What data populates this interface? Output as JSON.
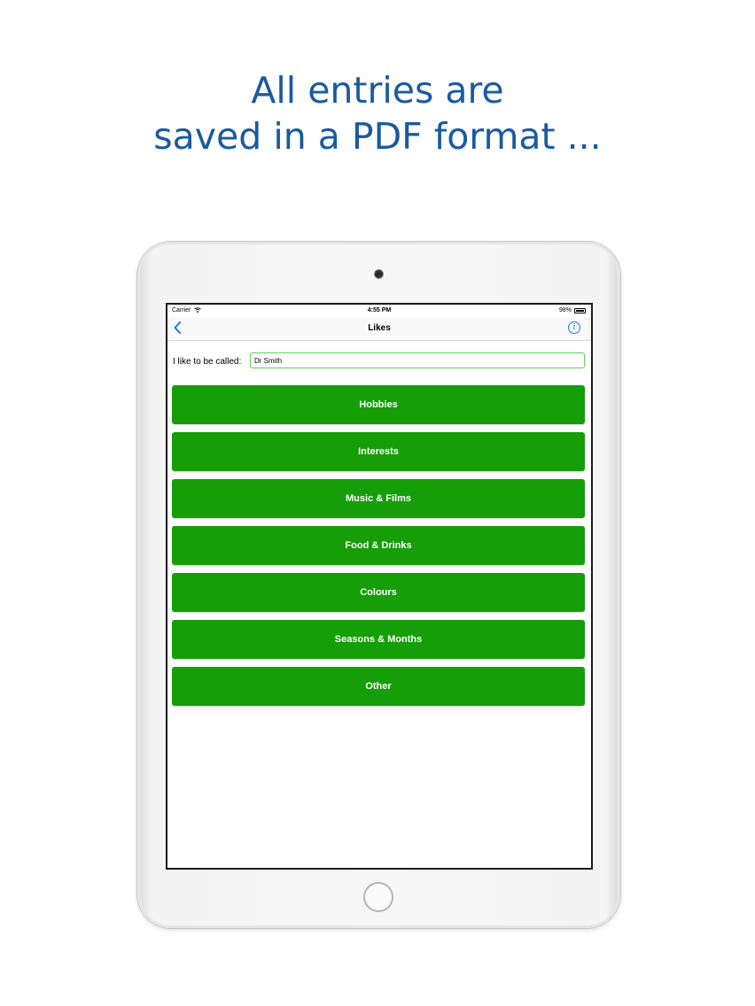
{
  "headline": {
    "line1": "All entries are",
    "line2": "saved in a PDF format ..."
  },
  "status_bar": {
    "carrier": "Carrier",
    "time": "4:55 PM",
    "battery": "98%"
  },
  "nav": {
    "title": "Likes",
    "back_icon": "chevron-left-icon",
    "info_icon": "info-icon"
  },
  "form": {
    "label": "I like to be called:",
    "value": "Dr Smith"
  },
  "menu": {
    "items": [
      {
        "label": "Hobbies"
      },
      {
        "label": "Interests"
      },
      {
        "label": "Music & Films"
      },
      {
        "label": "Food & Drinks"
      },
      {
        "label": "Colours"
      },
      {
        "label": "Seasons & Months"
      },
      {
        "label": "Other"
      }
    ]
  },
  "colors": {
    "headline": "#1a5aa0",
    "button": "#159e08",
    "accent": "#1577e6"
  }
}
